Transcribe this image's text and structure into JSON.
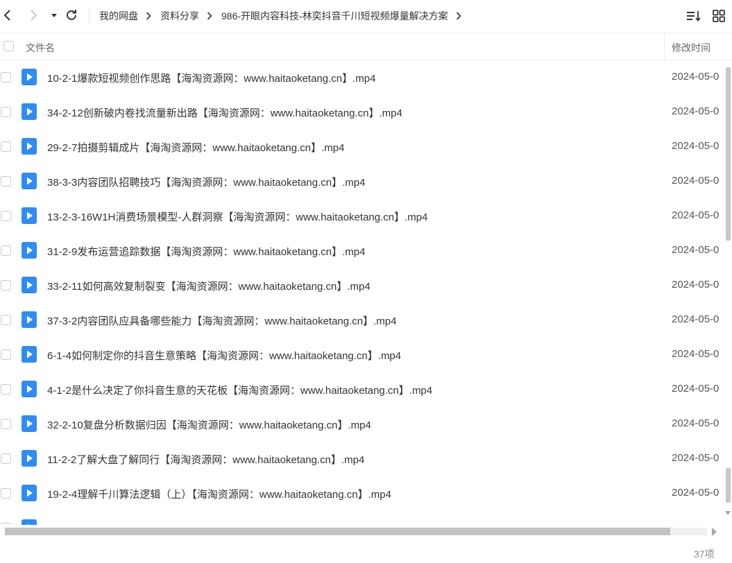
{
  "toolbar": {
    "back_icon": "chevron-left-icon",
    "forward_icon": "chevron-right-icon",
    "dropdown_icon": "caret-down-icon",
    "refresh_icon": "refresh-icon",
    "sort_icon": "sort-list-icon",
    "grid_icon": "grid-view-icon"
  },
  "breadcrumb": [
    {
      "label": "我的网盘"
    },
    {
      "label": "资料分享"
    },
    {
      "label": "986-开眼内容科技-林奕抖音千川短视频爆量解决方案"
    }
  ],
  "columns": {
    "name": "文件名",
    "modified": "修改时间"
  },
  "files": [
    {
      "name": "10-2-1爆款短视频创作思路【海淘资源网：www.haitaoketang.cn】.mp4",
      "modified": "2024-05-0"
    },
    {
      "name": "34-2-12创新破内卷找流量新出路【海淘资源网：www.haitaoketang.cn】.mp4",
      "modified": "2024-05-0"
    },
    {
      "name": "29-2-7拍摄剪辑成片【海淘资源网：www.haitaoketang.cn】.mp4",
      "modified": "2024-05-0"
    },
    {
      "name": "38-3-3内容团队招聘技巧【海淘资源网：www.haitaoketang.cn】.mp4",
      "modified": "2024-05-0"
    },
    {
      "name": "13-2-3-16W1H消费场景模型-人群洞察【海淘资源网：www.haitaoketang.cn】.mp4",
      "modified": "2024-05-0"
    },
    {
      "name": "31-2-9发布运营追踪数据【海淘资源网：www.haitaoketang.cn】.mp4",
      "modified": "2024-05-0"
    },
    {
      "name": "33-2-11如何高效复制裂变【海淘资源网：www.haitaoketang.cn】.mp4",
      "modified": "2024-05-0"
    },
    {
      "name": "37-3-2内容团队应具备哪些能力【海淘资源网：www.haitaoketang.cn】.mp4",
      "modified": "2024-05-0"
    },
    {
      "name": "6-1-4如何制定你的抖音生意策略【海淘资源网：www.haitaoketang.cn】.mp4",
      "modified": "2024-05-0"
    },
    {
      "name": "4-1-2是什么决定了你抖音生意的天花板【海淘资源网：www.haitaoketang.cn】.mp4",
      "modified": "2024-05-0"
    },
    {
      "name": "32-2-10复盘分析数据归因【海淘资源网：www.haitaoketang.cn】.mp4",
      "modified": "2024-05-0"
    },
    {
      "name": "11-2-2了解大盘了解同行【海淘资源网：www.haitaoketang.cn】.mp4",
      "modified": "2024-05-0"
    },
    {
      "name": "19-2-4理解千川算法逻辑（上）【海淘资源网：www.haitaoketang.cn】.mp4",
      "modified": "2024-05-0"
    }
  ],
  "file_icon": "video-file-icon",
  "colors": {
    "accent": "#2f8cf3",
    "icon_dark": "#333333"
  },
  "footer": {
    "count": "37项"
  }
}
